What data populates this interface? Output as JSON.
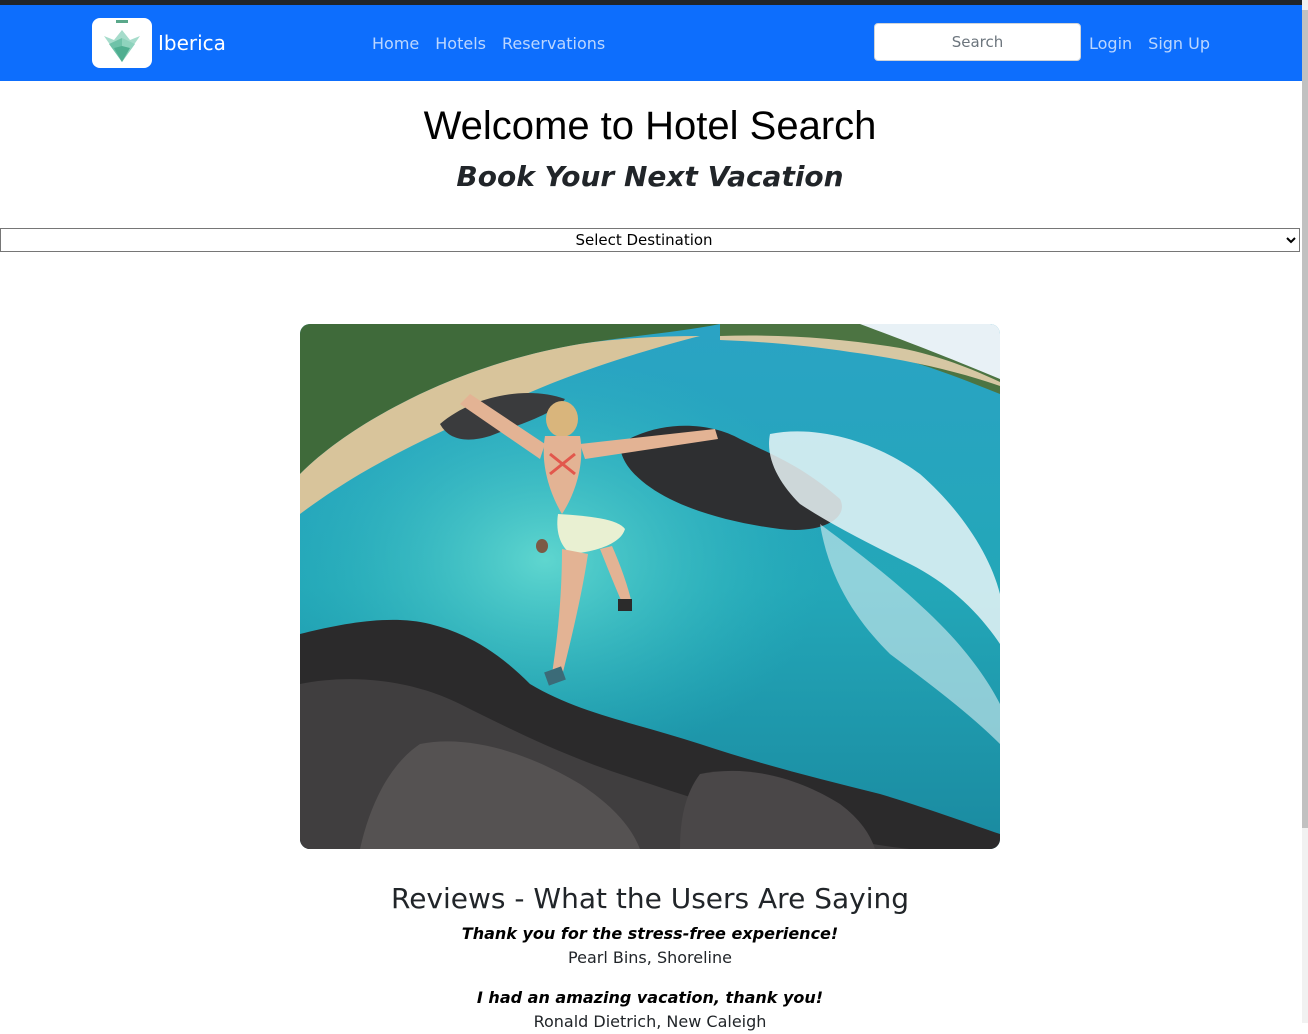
{
  "brand": {
    "name": "Iberica",
    "logo_icon": "folded-book-logo",
    "accent": "#0d6efd"
  },
  "nav": {
    "links": [
      {
        "label": "Home"
      },
      {
        "label": "Hotels"
      },
      {
        "label": "Reservations"
      }
    ]
  },
  "search": {
    "placeholder": "Search",
    "value": ""
  },
  "auth": {
    "login_label": "Login",
    "signup_label": "Sign Up"
  },
  "hero": {
    "title": "Welcome to Hotel Search",
    "subtitle": "Book Your Next Vacation",
    "destination_select": {
      "selected": "Select Destination"
    }
  },
  "reviews": {
    "title": "Reviews - What the Users Are Saying",
    "items": [
      {
        "quote": "Thank you for the stress-free experience!",
        "author": "Pearl Bins, Shoreline"
      },
      {
        "quote": "I had an amazing vacation, thank you!",
        "author": "Ronald Dietrich, New Caleigh"
      }
    ]
  }
}
